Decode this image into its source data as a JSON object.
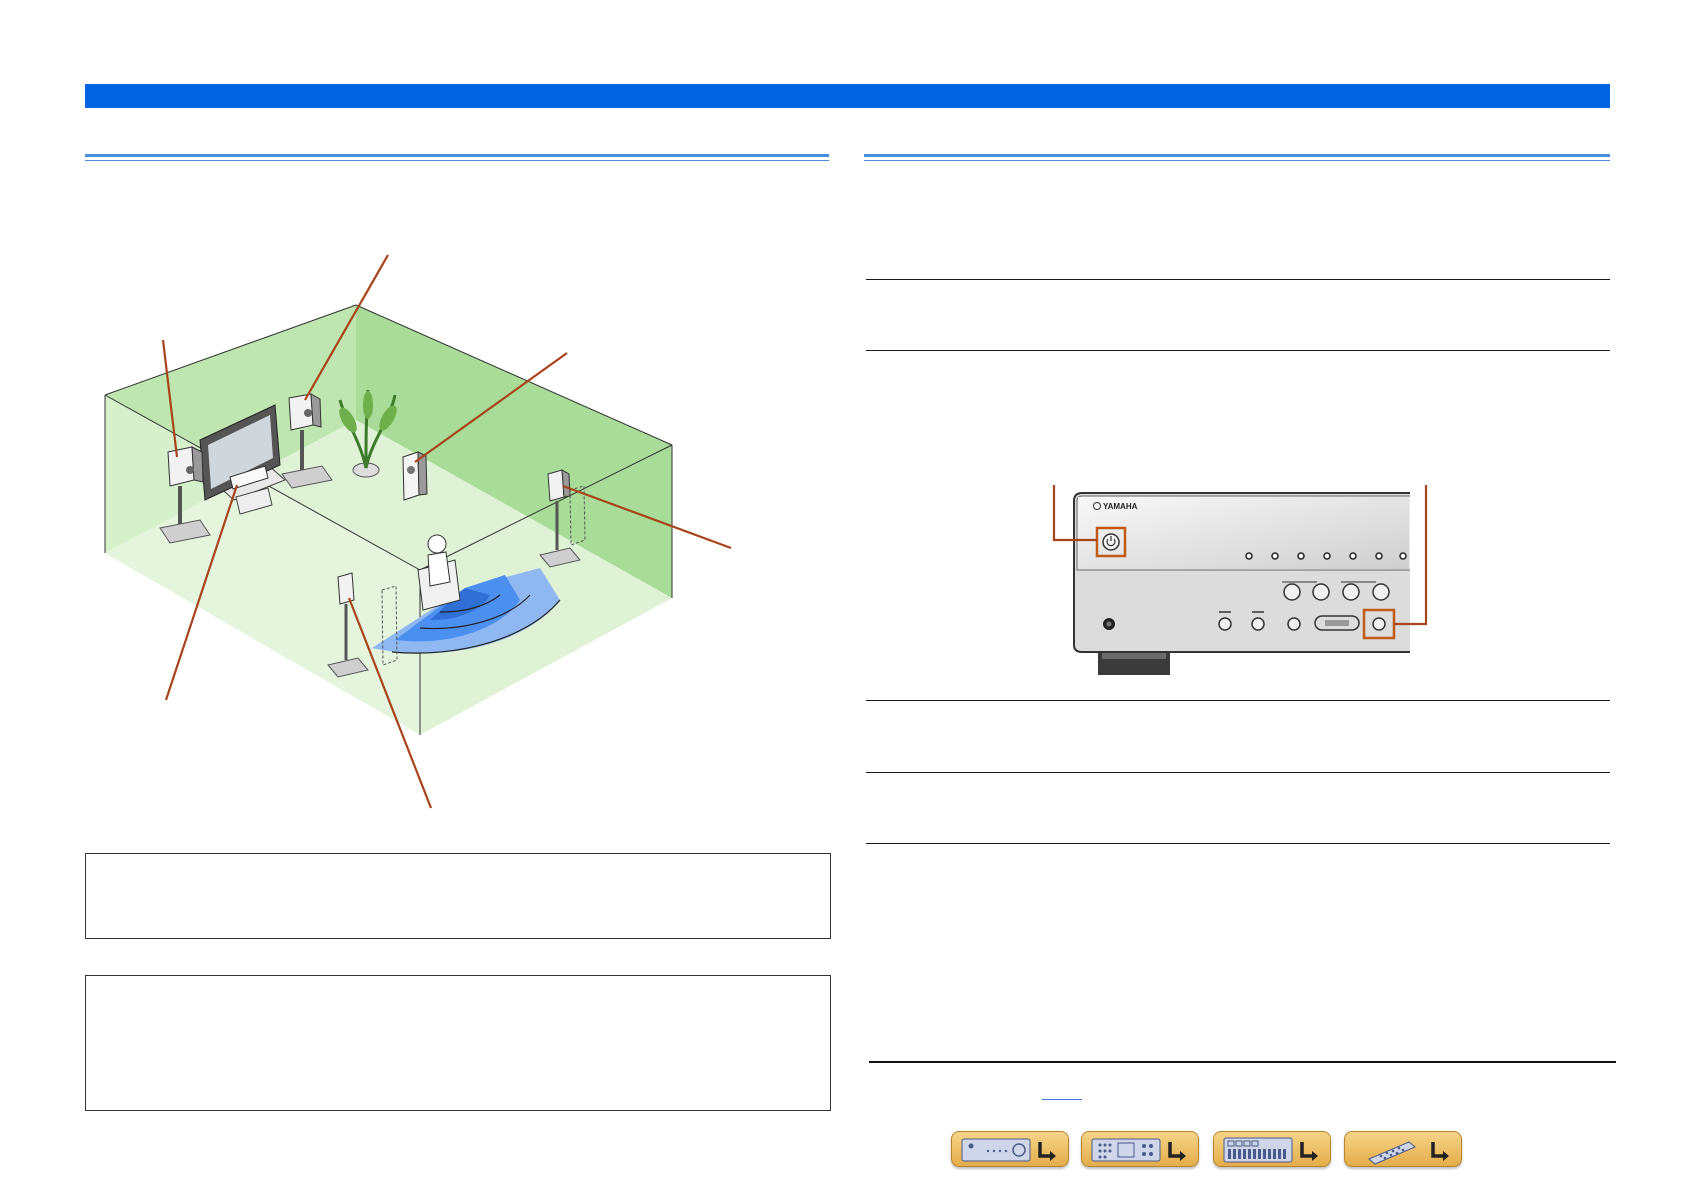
{
  "colors": {
    "title_bar": "#0064e1",
    "section_rule": "#4a8fe0",
    "callout_line": "#a8441b",
    "room_wall": "#bfe6b0",
    "listening_zone": "#4b8ff0",
    "nav_button": "#e9b95a"
  },
  "illustration": {
    "room_layout": "speaker-placement-room-diagram-icon",
    "receiver_panel": "receiver-front-panel-icon",
    "receiver_brand_logo": "YAMAHA"
  },
  "nav": {
    "buttons": [
      {
        "icon": "front-panel-icon"
      },
      {
        "icon": "rear-panel-icon"
      },
      {
        "icon": "display-icon"
      },
      {
        "icon": "remote-control-icon"
      }
    ]
  }
}
